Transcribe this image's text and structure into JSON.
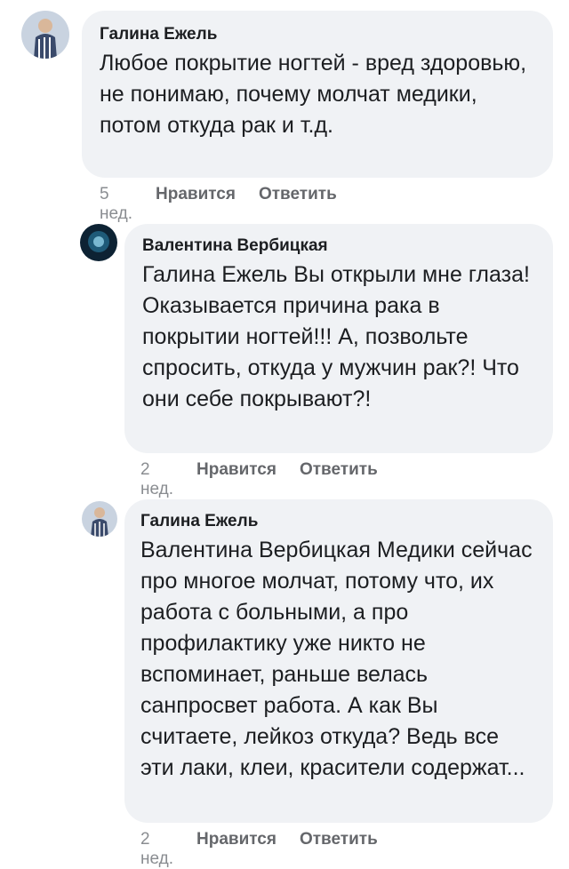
{
  "comments": [
    {
      "author": "Галина Ежель",
      "text": "Любое покрытие ногтей - вред здоровью, не понимаю, почему молчат медики, потом откуда рак и т.д.",
      "time": "5 нед.",
      "like_label": "Нравится",
      "reply_label": "Ответить"
    },
    {
      "author": "Валентина Вербицкая",
      "text": "Галина Ежель Вы открыли мне глаза!  Оказывается причина рака в покрытии ногтей!!!  А, позвольте спросить,  откуда у мужчин рак?!  Что они себе покрывают?!",
      "time": "2 нед.",
      "like_label": "Нравится",
      "reply_label": "Ответить"
    },
    {
      "author": "Галина Ежель",
      "text": "Валентина Вербицкая Медики сейчас про многое молчат, потому что, их работа с больными, а про профилактику уже никто не вспоминает, раньше велась санпросвет работа. А как Вы считаете, лейкоз откуда? Ведь все эти лаки, клеи, красители содержат...",
      "time": "2 нед.",
      "like_label": "Нравится",
      "reply_label": "Ответить"
    }
  ],
  "colors": {
    "bubble": "#f0f2f5",
    "meta": "#65676b"
  }
}
